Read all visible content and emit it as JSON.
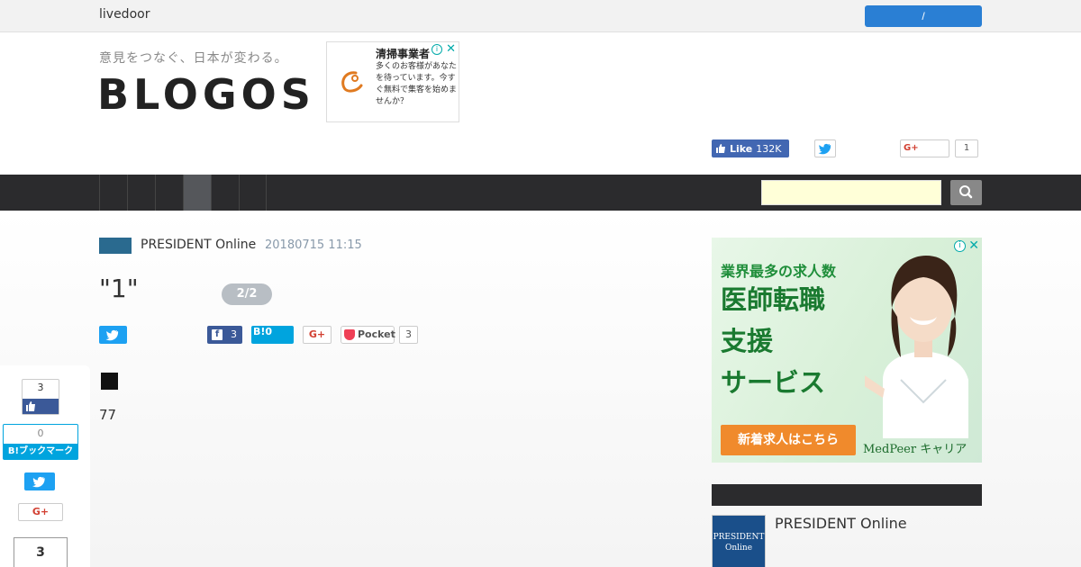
{
  "topbar": {
    "brand": "livedoor",
    "login_label": "/"
  },
  "header": {
    "tagline": "意見をつなぐ、日本が変わる。",
    "logo": "BLOGOS"
  },
  "small_ad": {
    "title": "清掃事業者",
    "body": "多くのお客様があなたを待っています。今すぐ無料で集客を始めませんか？",
    "info": "i",
    "close": "✕"
  },
  "social_top": {
    "fb_like": "Like",
    "fb_count": "132K",
    "gplus": "G+",
    "gplus_count": "1"
  },
  "nav": {
    "items": [
      "",
      "",
      "",
      "",
      "",
      ""
    ],
    "active_index": 3
  },
  "search": {
    "placeholder": ""
  },
  "article": {
    "source": "PRESIDENT Online",
    "date": "20180715 11:15",
    "title": "\"1\"",
    "page_indicator": "2/2",
    "share": {
      "fb_count": "3",
      "hatena": "B!0",
      "gplus": "G+",
      "pocket": "Pocket",
      "pocket_count": "3"
    },
    "body_symbol": "■",
    "body_number": "77"
  },
  "side_share": {
    "fb_count": "3",
    "hatena_count": "0",
    "hatena_label": "B!ブックマーク",
    "gplus": "G+",
    "total_count": "3"
  },
  "big_ad": {
    "line1": "業界最多の求人数",
    "line2": "医師転職",
    "line3": "支援",
    "line4": "サービス",
    "cta": "新着求人はこちら",
    "brand": "MedPeer キャリア",
    "info": "i",
    "close": "✕"
  },
  "sidebar": {
    "thumb_text": "PRESIDENT Online",
    "name": "PRESIDENT Online"
  },
  "colors": {
    "accent_blue": "#2a7fd4",
    "nav_bg": "#2b2b2d",
    "twitter": "#1da1f2",
    "facebook": "#3b5998",
    "hatena": "#00a4de",
    "ad_green": "#1a7a30",
    "ad_cta": "#f08a2c"
  }
}
